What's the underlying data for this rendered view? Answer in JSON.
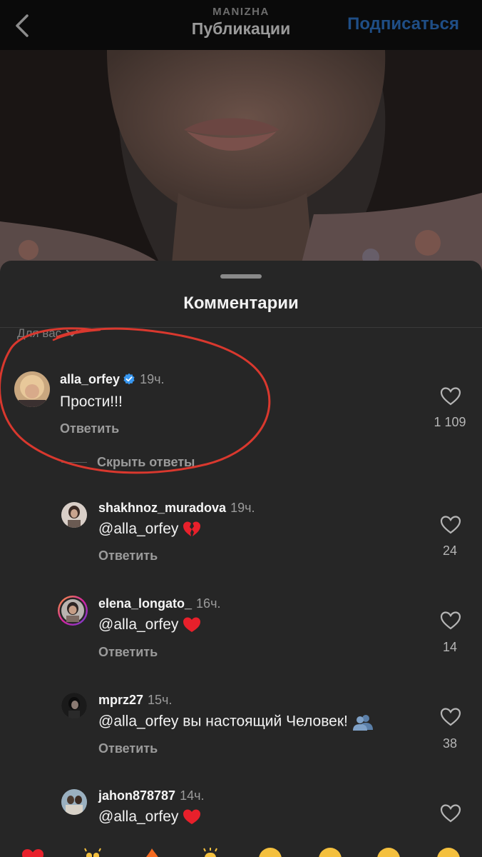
{
  "header": {
    "account": "MANIZHA",
    "title": "Публикации",
    "follow_label": "Подписаться"
  },
  "comments_sheet": {
    "title": "Комментарии",
    "sort_label": "Для вас",
    "hide_replies_label": "Скрыть ответы",
    "reply_label": "Ответить",
    "main_comment": {
      "username": "alla_orfey",
      "time": "19ч.",
      "text": "Прости!!!",
      "likes": "1 109",
      "verified": true
    },
    "replies": [
      {
        "username": "shakhnoz_muradova",
        "time": "19ч.",
        "mention": "@alla_orfey",
        "text": "",
        "emoji": "broken-heart",
        "likes": "24"
      },
      {
        "username": "elena_longato_",
        "time": "16ч.",
        "mention": "@alla_orfey",
        "text": "",
        "emoji": "red-heart",
        "likes": "14"
      },
      {
        "username": "mprz27",
        "time": "15ч.",
        "mention": "@alla_orfey",
        "text": " вы настоящий Человек!",
        "emoji": "busts-in-silhouette",
        "likes": "38"
      },
      {
        "username": "jahon878787",
        "time": "14ч.",
        "mention": "@alla_orfey",
        "text": "",
        "emoji": "red-heart",
        "likes": ""
      }
    ]
  },
  "emoji_bar": [
    "red-heart",
    "raising-hands",
    "fire",
    "clapping-hands",
    "crying-face",
    "heart-eyes-face",
    "surprised-face",
    "laughing-face"
  ],
  "colors": {
    "background": "#262626",
    "topbar": "#0a0a0a",
    "follow_blue": "#1f4e86",
    "verified_blue": "#3897f0",
    "heart_red": "#e8202b",
    "annotation_red": "#d9382e"
  }
}
